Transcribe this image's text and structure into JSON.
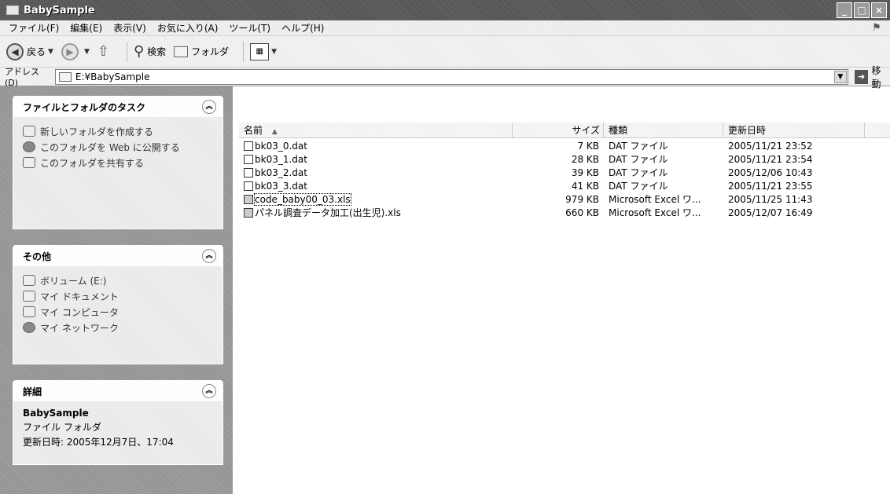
{
  "window": {
    "title": "BabySample"
  },
  "menu": [
    "ファイル(F)",
    "編集(E)",
    "表示(V)",
    "お気に入り(A)",
    "ツール(T)",
    "ヘルプ(H)"
  ],
  "toolbar": {
    "back": "戻る",
    "search": "検索",
    "folders": "フォルダ"
  },
  "address": {
    "label": "アドレス(D)",
    "path": "E:¥BabySample",
    "go": "移動"
  },
  "taskpane": {
    "tasks": {
      "title": "ファイルとフォルダのタスク",
      "items": [
        "新しいフォルダを作成する",
        "このフォルダを Web に公開する",
        "このフォルダを共有する"
      ]
    },
    "other": {
      "title": "その他",
      "items": [
        "ボリューム (E:)",
        "マイ ドキュメント",
        "マイ コンピュータ",
        "マイ ネットワーク"
      ]
    },
    "details": {
      "title": "詳細",
      "name": "BabySample",
      "type": "ファイル フォルダ",
      "modified": "更新日時: 2005年12月7日、17:04"
    }
  },
  "columns": {
    "name": "名前",
    "size": "サイズ",
    "type": "種類",
    "modified": "更新日時"
  },
  "files": [
    {
      "name": "bk03_0.dat",
      "size": "7 KB",
      "type": "DAT ファイル",
      "modified": "2005/11/21 23:52"
    },
    {
      "name": "bk03_1.dat",
      "size": "28 KB",
      "type": "DAT ファイル",
      "modified": "2005/11/21 23:54"
    },
    {
      "name": "bk03_2.dat",
      "size": "39 KB",
      "type": "DAT ファイル",
      "modified": "2005/12/06 10:43"
    },
    {
      "name": "bk03_3.dat",
      "size": "41 KB",
      "type": "DAT ファイル",
      "modified": "2005/11/21 23:55"
    },
    {
      "name": "code_baby00_03.xls",
      "size": "979 KB",
      "type": "Microsoft Excel ワ...",
      "modified": "2005/11/25 11:43"
    },
    {
      "name": "パネル調査データ加工(出生児).xls",
      "size": "660 KB",
      "type": "Microsoft Excel ワ...",
      "modified": "2005/12/07 16:49"
    }
  ]
}
